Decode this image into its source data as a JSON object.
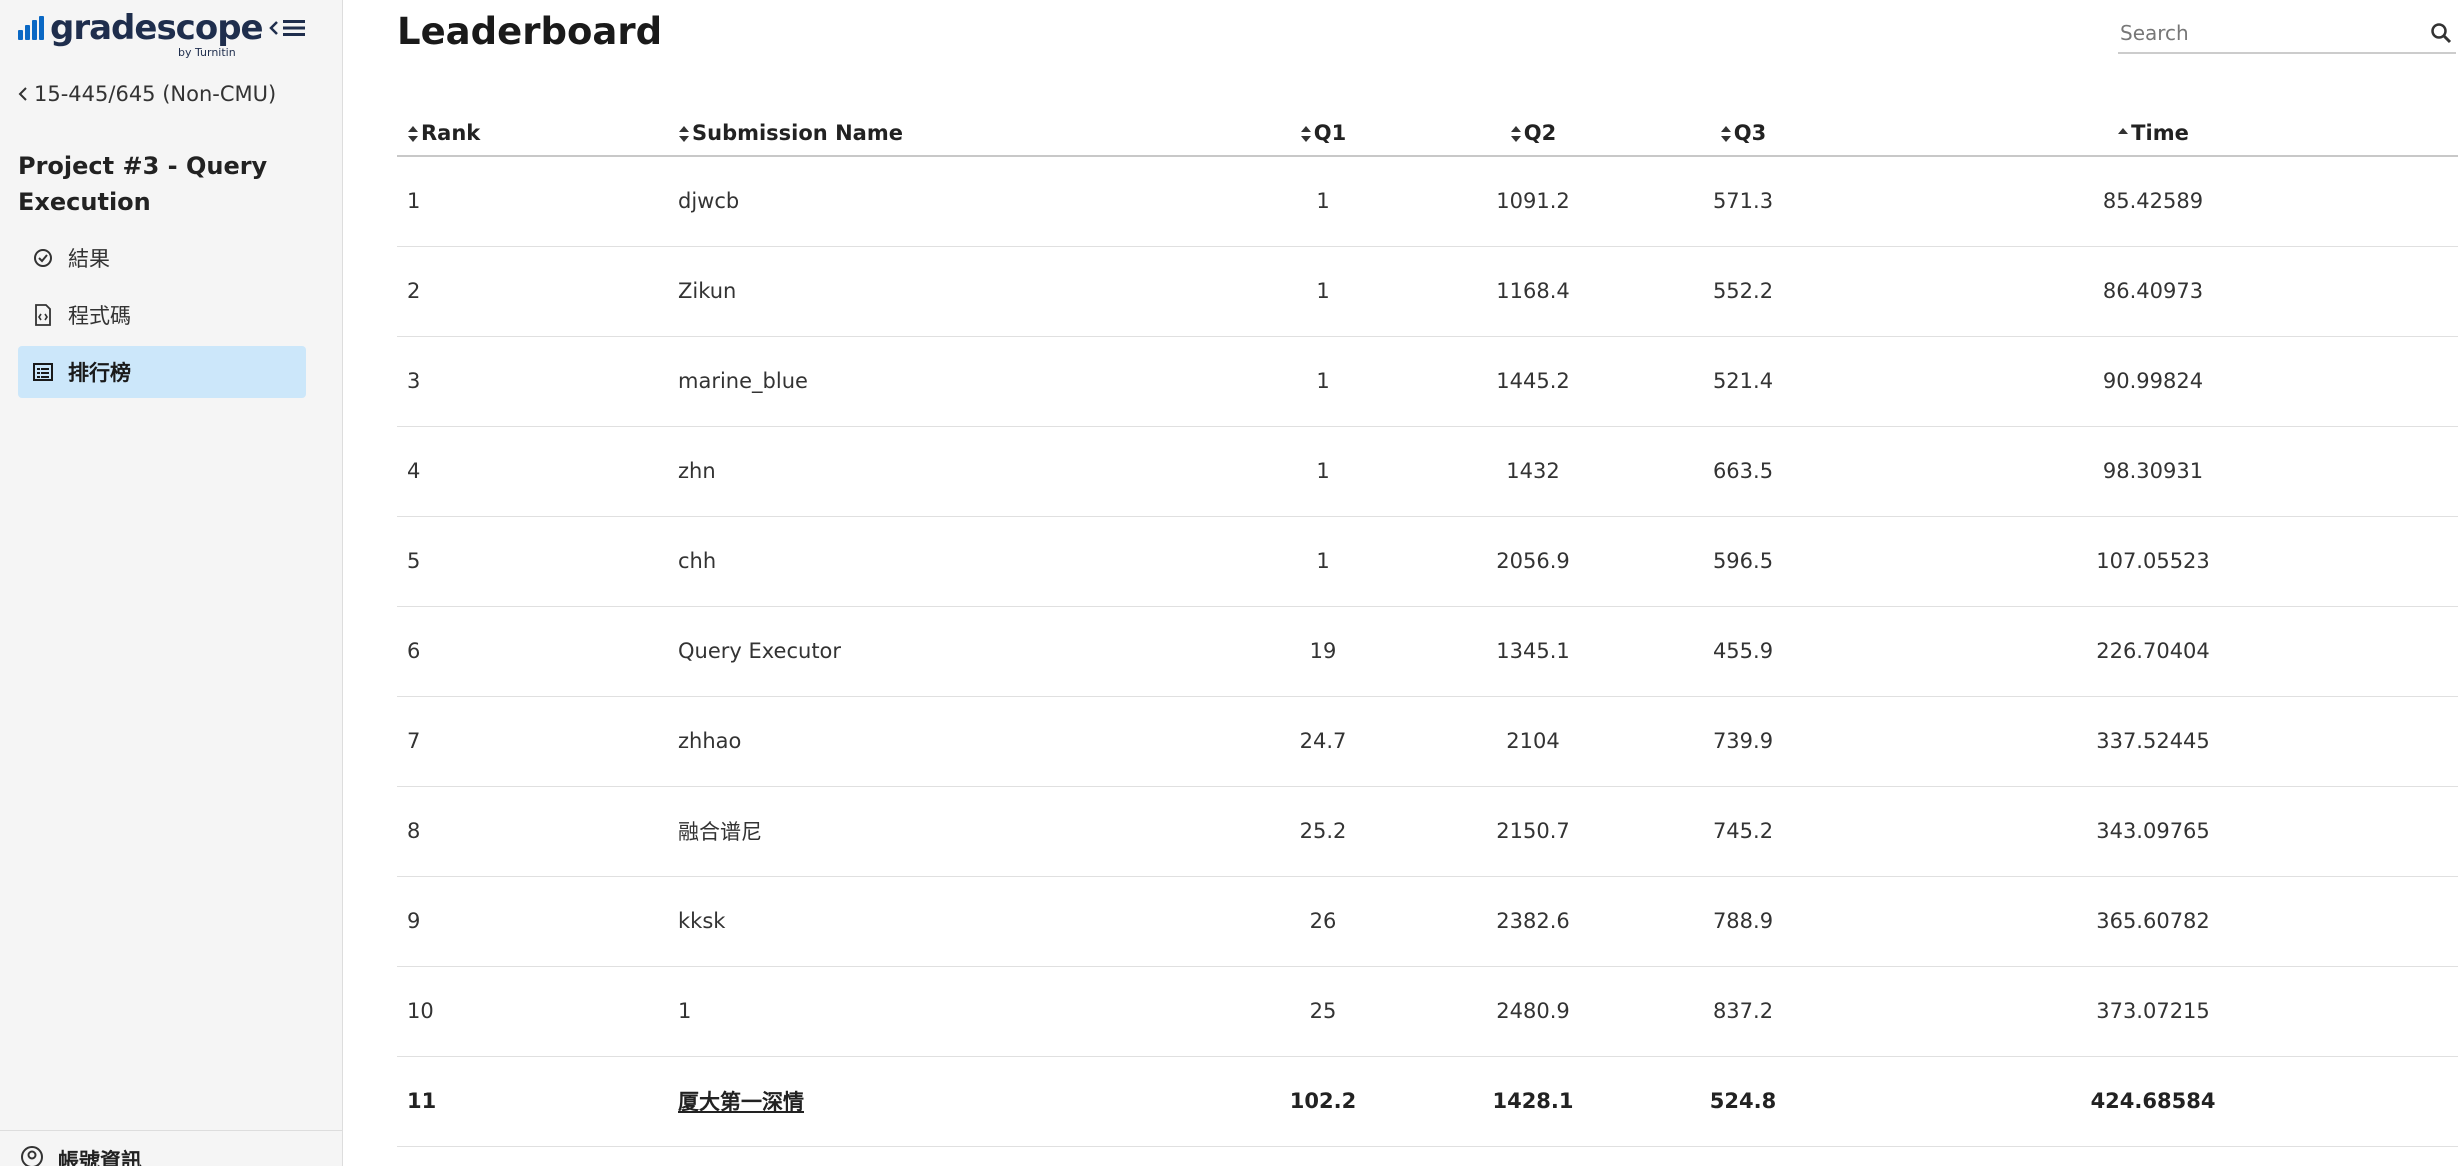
{
  "brand": {
    "logo_text": "gradescope",
    "logo_sub": "by Turnitin",
    "primary_color": "#0a68c4",
    "nav_active_bg": "#cce7fa"
  },
  "sidebar": {
    "back_label": "15-445/645 (Non-CMU)",
    "assignment_title": "Project #3 - Query Execution",
    "items": [
      {
        "label": "結果",
        "icon": "check-circle-icon",
        "active": false
      },
      {
        "label": "程式碼",
        "icon": "code-file-icon",
        "active": false
      },
      {
        "label": "排行榜",
        "icon": "table-list-icon",
        "active": true
      }
    ],
    "bottom_label": "帳號資訊"
  },
  "header": {
    "title": "Leaderboard",
    "search_placeholder": "Search"
  },
  "table": {
    "columns": [
      "Rank",
      "Submission Name",
      "Q1",
      "Q2",
      "Q3",
      "Time"
    ],
    "sorted_column": "Time",
    "sort_direction": "ascending",
    "rows": [
      {
        "rank": "1",
        "name": "djwcb",
        "q1": "1",
        "q2": "1091.2",
        "q3": "571.3",
        "time": "85.42589"
      },
      {
        "rank": "2",
        "name": "Zikun",
        "q1": "1",
        "q2": "1168.4",
        "q3": "552.2",
        "time": "86.40973"
      },
      {
        "rank": "3",
        "name": "marine_blue",
        "q1": "1",
        "q2": "1445.2",
        "q3": "521.4",
        "time": "90.99824"
      },
      {
        "rank": "4",
        "name": "zhn",
        "q1": "1",
        "q2": "1432",
        "q3": "663.5",
        "time": "98.30931"
      },
      {
        "rank": "5",
        "name": "chh",
        "q1": "1",
        "q2": "2056.9",
        "q3": "596.5",
        "time": "107.05523"
      },
      {
        "rank": "6",
        "name": "Query Executor",
        "q1": "19",
        "q2": "1345.1",
        "q3": "455.9",
        "time": "226.70404"
      },
      {
        "rank": "7",
        "name": "zhhao",
        "q1": "24.7",
        "q2": "2104",
        "q3": "739.9",
        "time": "337.52445"
      },
      {
        "rank": "8",
        "name": "融合谱尼",
        "q1": "25.2",
        "q2": "2150.7",
        "q3": "745.2",
        "time": "343.09765"
      },
      {
        "rank": "9",
        "name": "kksk",
        "q1": "26",
        "q2": "2382.6",
        "q3": "788.9",
        "time": "365.60782"
      },
      {
        "rank": "10",
        "name": "1",
        "q1": "25",
        "q2": "2480.9",
        "q3": "837.2",
        "time": "373.07215"
      },
      {
        "rank": "11",
        "name": "厦大第一深情",
        "q1": "102.2",
        "q2": "1428.1",
        "q3": "524.8",
        "time": "424.68584",
        "highlight": true
      }
    ]
  }
}
